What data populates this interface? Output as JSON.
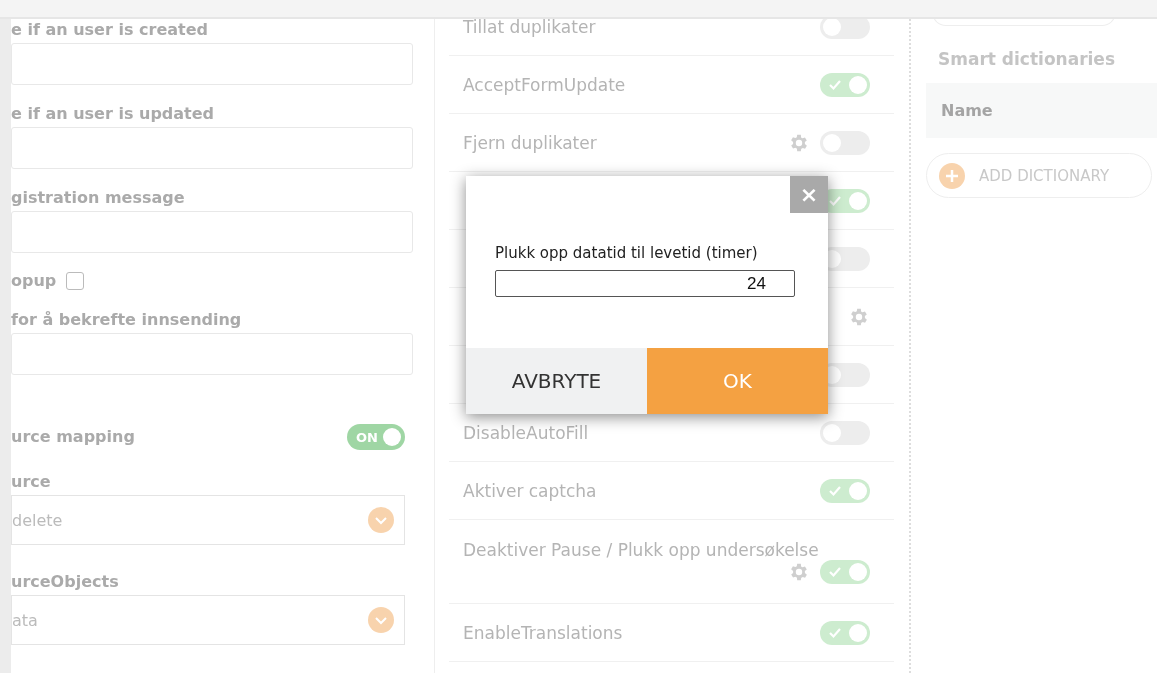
{
  "left_panel": {
    "fields": [
      {
        "kind": "text",
        "label": "e if an user is created"
      },
      {
        "kind": "text",
        "label": "e if an user is updated"
      },
      {
        "kind": "text",
        "label": "gistration message"
      },
      {
        "kind": "checkbox",
        "label": "opup",
        "checked": false
      },
      {
        "kind": "text",
        "label": "for å bekrefte innsending"
      },
      {
        "kind": "toggle",
        "label": "urce mapping",
        "on": true,
        "toggle_text": "ON"
      },
      {
        "kind": "select",
        "label": "urce",
        "value": "delete"
      },
      {
        "kind": "select",
        "label": "urceObjects",
        "value": "ata"
      }
    ]
  },
  "settings": [
    {
      "kind": "toggle",
      "label": "Tillat duplikater",
      "on": false,
      "gear": false
    },
    {
      "kind": "toggle",
      "label": "AcceptFormUpdate",
      "on": true,
      "gear": false
    },
    {
      "kind": "toggle",
      "label": "Fjern duplikater",
      "on": false,
      "gear": true
    },
    {
      "kind": "toggle",
      "on": true,
      "gear": false
    },
    {
      "kind": "toggle",
      "on": false,
      "gear": false
    },
    {
      "kind": "gear-only",
      "gear": true
    },
    {
      "kind": "toggle",
      "on": false,
      "gear": false
    },
    {
      "kind": "toggle",
      "label": "DisableAutoFill",
      "on": false,
      "gear": false
    },
    {
      "kind": "toggle",
      "label": "Aktiver captcha",
      "on": true,
      "gear": false
    },
    {
      "kind": "toggle",
      "label": "Deaktiver Pause / Plukk opp undersøkelse",
      "on": true,
      "gear": true
    },
    {
      "kind": "toggle",
      "label": "EnableTranslations",
      "on": true,
      "gear": false
    }
  ],
  "right_panel": {
    "title": "Smart dictionaries",
    "table": {
      "columns": [
        "Name"
      ]
    },
    "add_button": "ADD DICTIONARY"
  },
  "dialog": {
    "close": "×",
    "label": "Plukk opp datatid til levetid (timer)",
    "value": "24",
    "buttons": [
      {
        "kind": "cancel",
        "label": "AVBRYTE"
      },
      {
        "kind": "primary",
        "label": "OK"
      }
    ]
  }
}
